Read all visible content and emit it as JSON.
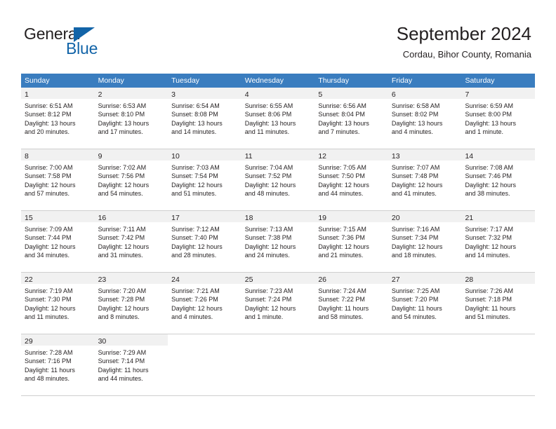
{
  "brand": {
    "name_part1": "General",
    "name_part2": "Blue",
    "accent_color": "#1264a8"
  },
  "header": {
    "title": "September 2024",
    "subtitle": "Cordau, Bihor County, Romania"
  },
  "calendar": {
    "header_color": "#3a7dbf",
    "daynum_row_color": "#f1f1f1",
    "weekdays": [
      "Sunday",
      "Monday",
      "Tuesday",
      "Wednesday",
      "Thursday",
      "Friday",
      "Saturday"
    ],
    "weeks": [
      [
        {
          "day": "1",
          "sunrise": "Sunrise: 6:51 AM",
          "sunset": "Sunset: 8:12 PM",
          "daylight1": "Daylight: 13 hours",
          "daylight2": "and 20 minutes."
        },
        {
          "day": "2",
          "sunrise": "Sunrise: 6:53 AM",
          "sunset": "Sunset: 8:10 PM",
          "daylight1": "Daylight: 13 hours",
          "daylight2": "and 17 minutes."
        },
        {
          "day": "3",
          "sunrise": "Sunrise: 6:54 AM",
          "sunset": "Sunset: 8:08 PM",
          "daylight1": "Daylight: 13 hours",
          "daylight2": "and 14 minutes."
        },
        {
          "day": "4",
          "sunrise": "Sunrise: 6:55 AM",
          "sunset": "Sunset: 8:06 PM",
          "daylight1": "Daylight: 13 hours",
          "daylight2": "and 11 minutes."
        },
        {
          "day": "5",
          "sunrise": "Sunrise: 6:56 AM",
          "sunset": "Sunset: 8:04 PM",
          "daylight1": "Daylight: 13 hours",
          "daylight2": "and 7 minutes."
        },
        {
          "day": "6",
          "sunrise": "Sunrise: 6:58 AM",
          "sunset": "Sunset: 8:02 PM",
          "daylight1": "Daylight: 13 hours",
          "daylight2": "and 4 minutes."
        },
        {
          "day": "7",
          "sunrise": "Sunrise: 6:59 AM",
          "sunset": "Sunset: 8:00 PM",
          "daylight1": "Daylight: 13 hours",
          "daylight2": "and 1 minute."
        }
      ],
      [
        {
          "day": "8",
          "sunrise": "Sunrise: 7:00 AM",
          "sunset": "Sunset: 7:58 PM",
          "daylight1": "Daylight: 12 hours",
          "daylight2": "and 57 minutes."
        },
        {
          "day": "9",
          "sunrise": "Sunrise: 7:02 AM",
          "sunset": "Sunset: 7:56 PM",
          "daylight1": "Daylight: 12 hours",
          "daylight2": "and 54 minutes."
        },
        {
          "day": "10",
          "sunrise": "Sunrise: 7:03 AM",
          "sunset": "Sunset: 7:54 PM",
          "daylight1": "Daylight: 12 hours",
          "daylight2": "and 51 minutes."
        },
        {
          "day": "11",
          "sunrise": "Sunrise: 7:04 AM",
          "sunset": "Sunset: 7:52 PM",
          "daylight1": "Daylight: 12 hours",
          "daylight2": "and 48 minutes."
        },
        {
          "day": "12",
          "sunrise": "Sunrise: 7:05 AM",
          "sunset": "Sunset: 7:50 PM",
          "daylight1": "Daylight: 12 hours",
          "daylight2": "and 44 minutes."
        },
        {
          "day": "13",
          "sunrise": "Sunrise: 7:07 AM",
          "sunset": "Sunset: 7:48 PM",
          "daylight1": "Daylight: 12 hours",
          "daylight2": "and 41 minutes."
        },
        {
          "day": "14",
          "sunrise": "Sunrise: 7:08 AM",
          "sunset": "Sunset: 7:46 PM",
          "daylight1": "Daylight: 12 hours",
          "daylight2": "and 38 minutes."
        }
      ],
      [
        {
          "day": "15",
          "sunrise": "Sunrise: 7:09 AM",
          "sunset": "Sunset: 7:44 PM",
          "daylight1": "Daylight: 12 hours",
          "daylight2": "and 34 minutes."
        },
        {
          "day": "16",
          "sunrise": "Sunrise: 7:11 AM",
          "sunset": "Sunset: 7:42 PM",
          "daylight1": "Daylight: 12 hours",
          "daylight2": "and 31 minutes."
        },
        {
          "day": "17",
          "sunrise": "Sunrise: 7:12 AM",
          "sunset": "Sunset: 7:40 PM",
          "daylight1": "Daylight: 12 hours",
          "daylight2": "and 28 minutes."
        },
        {
          "day": "18",
          "sunrise": "Sunrise: 7:13 AM",
          "sunset": "Sunset: 7:38 PM",
          "daylight1": "Daylight: 12 hours",
          "daylight2": "and 24 minutes."
        },
        {
          "day": "19",
          "sunrise": "Sunrise: 7:15 AM",
          "sunset": "Sunset: 7:36 PM",
          "daylight1": "Daylight: 12 hours",
          "daylight2": "and 21 minutes."
        },
        {
          "day": "20",
          "sunrise": "Sunrise: 7:16 AM",
          "sunset": "Sunset: 7:34 PM",
          "daylight1": "Daylight: 12 hours",
          "daylight2": "and 18 minutes."
        },
        {
          "day": "21",
          "sunrise": "Sunrise: 7:17 AM",
          "sunset": "Sunset: 7:32 PM",
          "daylight1": "Daylight: 12 hours",
          "daylight2": "and 14 minutes."
        }
      ],
      [
        {
          "day": "22",
          "sunrise": "Sunrise: 7:19 AM",
          "sunset": "Sunset: 7:30 PM",
          "daylight1": "Daylight: 12 hours",
          "daylight2": "and 11 minutes."
        },
        {
          "day": "23",
          "sunrise": "Sunrise: 7:20 AM",
          "sunset": "Sunset: 7:28 PM",
          "daylight1": "Daylight: 12 hours",
          "daylight2": "and 8 minutes."
        },
        {
          "day": "24",
          "sunrise": "Sunrise: 7:21 AM",
          "sunset": "Sunset: 7:26 PM",
          "daylight1": "Daylight: 12 hours",
          "daylight2": "and 4 minutes."
        },
        {
          "day": "25",
          "sunrise": "Sunrise: 7:23 AM",
          "sunset": "Sunset: 7:24 PM",
          "daylight1": "Daylight: 12 hours",
          "daylight2": "and 1 minute."
        },
        {
          "day": "26",
          "sunrise": "Sunrise: 7:24 AM",
          "sunset": "Sunset: 7:22 PM",
          "daylight1": "Daylight: 11 hours",
          "daylight2": "and 58 minutes."
        },
        {
          "day": "27",
          "sunrise": "Sunrise: 7:25 AM",
          "sunset": "Sunset: 7:20 PM",
          "daylight1": "Daylight: 11 hours",
          "daylight2": "and 54 minutes."
        },
        {
          "day": "28",
          "sunrise": "Sunrise: 7:26 AM",
          "sunset": "Sunset: 7:18 PM",
          "daylight1": "Daylight: 11 hours",
          "daylight2": "and 51 minutes."
        }
      ],
      [
        {
          "day": "29",
          "sunrise": "Sunrise: 7:28 AM",
          "sunset": "Sunset: 7:16 PM",
          "daylight1": "Daylight: 11 hours",
          "daylight2": "and 48 minutes."
        },
        {
          "day": "30",
          "sunrise": "Sunrise: 7:29 AM",
          "sunset": "Sunset: 7:14 PM",
          "daylight1": "Daylight: 11 hours",
          "daylight2": "and 44 minutes."
        },
        {
          "day": "",
          "sunrise": "",
          "sunset": "",
          "daylight1": "",
          "daylight2": ""
        },
        {
          "day": "",
          "sunrise": "",
          "sunset": "",
          "daylight1": "",
          "daylight2": ""
        },
        {
          "day": "",
          "sunrise": "",
          "sunset": "",
          "daylight1": "",
          "daylight2": ""
        },
        {
          "day": "",
          "sunrise": "",
          "sunset": "",
          "daylight1": "",
          "daylight2": ""
        },
        {
          "day": "",
          "sunrise": "",
          "sunset": "",
          "daylight1": "",
          "daylight2": ""
        }
      ]
    ]
  }
}
